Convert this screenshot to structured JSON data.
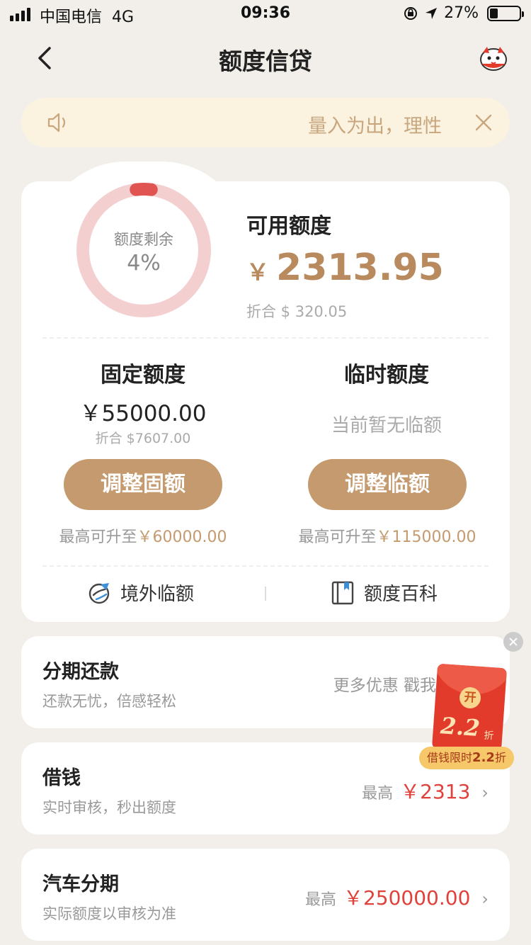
{
  "status_bar": {
    "carrier": "中国电信",
    "network": "4G",
    "time": "09:36",
    "battery": "27%",
    "battery_level": 0.27
  },
  "nav": {
    "title": "额度信贷",
    "back_icon": "chevron-left-icon",
    "mascot_icon": "mascot-icon"
  },
  "notice": {
    "text": "量入为出，理性",
    "speaker_icon": "speaker-icon",
    "close_icon": "close-icon"
  },
  "summary": {
    "ring_label": "额度剩余",
    "ring_percent": "4%",
    "ring_fraction": 0.04,
    "available_label": "可用额度",
    "currency_symbol": "￥",
    "available_amount": "2313.95",
    "available_usd": "折合 $ 320.05"
  },
  "fixed": {
    "title": "固定额度",
    "amount": "￥55000.00",
    "usd": "折合 $7607.00",
    "button": "调整固额",
    "max_prefix": "最高可升至",
    "max_value": "￥60000.00"
  },
  "temp": {
    "title": "临时额度",
    "none_text": "当前暂无临额",
    "button": "调整临额",
    "max_prefix": "最高可升至",
    "max_value": "￥115000.00"
  },
  "links": {
    "overseas": "境外临额",
    "encyclopedia": "额度百科"
  },
  "installment": {
    "title": "分期还款",
    "subtitle": "还款无忧，倍感轻松",
    "right": "更多优惠 戳我"
  },
  "loan": {
    "title": "借钱",
    "subtitle": "实时审核，秒出额度",
    "max_label": "最高",
    "max_value": "￥2313"
  },
  "car": {
    "title": "汽车分期",
    "subtitle": "实际额度以审核为准",
    "max_label": "最高",
    "max_value": "￥250000.00"
  },
  "promo": {
    "coin_char": "开",
    "discount": "2.2",
    "discount_suffix": "折",
    "pill_prefix": "借钱限时",
    "pill_value": "2.2",
    "pill_suffix": "折"
  },
  "colors": {
    "accent_gold": "#c49a6e",
    "amount_gold": "#b88a5e",
    "ring_track": "#f4cfd0",
    "ring_progress": "#e05552",
    "price_red": "#e0413b",
    "page_bg": "#f2efea"
  }
}
